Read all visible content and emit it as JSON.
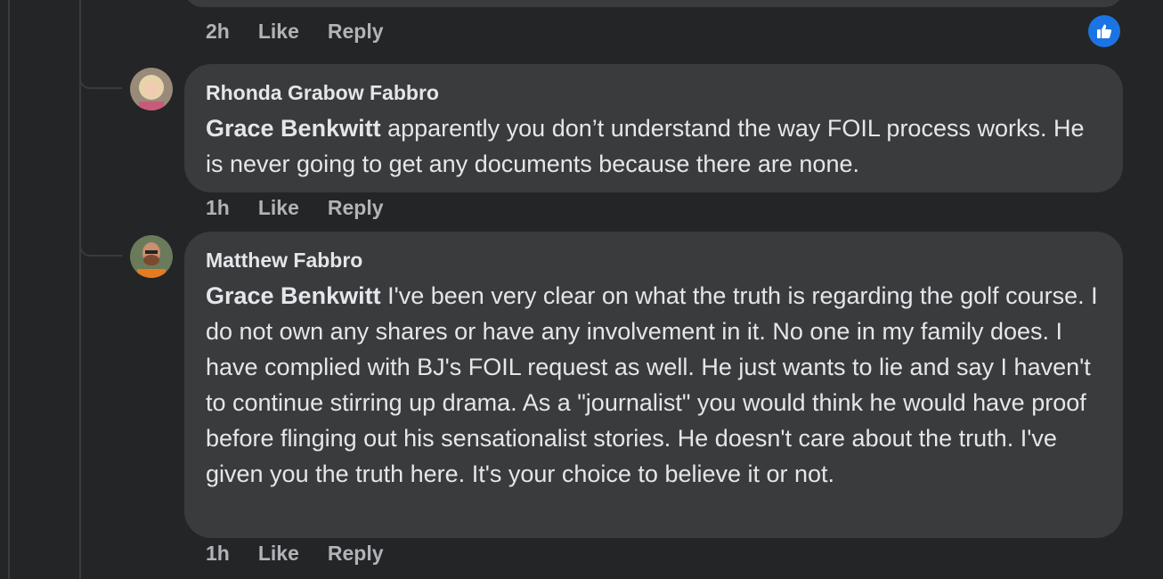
{
  "top_comment": {
    "actions": {
      "time": "2h",
      "like": "Like",
      "reply": "Reply"
    },
    "reaction_icon": "thumbs-up-icon",
    "reaction_color": "#1b74e4"
  },
  "comments": [
    {
      "author": "Rhonda Grabow Fabbro",
      "mention": "Grace Benkwitt",
      "text": " apparently you don’t understand the way FOIL process works. He is never going to get any documents because there are none.",
      "actions": {
        "time": "1h",
        "like": "Like",
        "reply": "Reply"
      }
    },
    {
      "author": "Matthew Fabbro",
      "mention": "Grace Benkwitt",
      "text": " I've been very clear on what the truth is regarding the golf course. I do not own any shares or have any involvement in it. No one in my family does. I have complied with BJ's FOIL request as well. He just wants to lie and say I haven't to continue stirring up drama. As a \"journalist\" you would think he would have proof before flinging out his sensationalist stories. He doesn't care about the truth. I've given you the truth here. It's your choice to believe it or not.",
      "actions": {
        "time": "1h",
        "like": "Like",
        "reply": "Reply"
      }
    }
  ],
  "colors": {
    "background": "#242526",
    "bubble": "#3a3b3c",
    "text": "#e4e6eb",
    "secondary_text": "#b0b3b8"
  }
}
